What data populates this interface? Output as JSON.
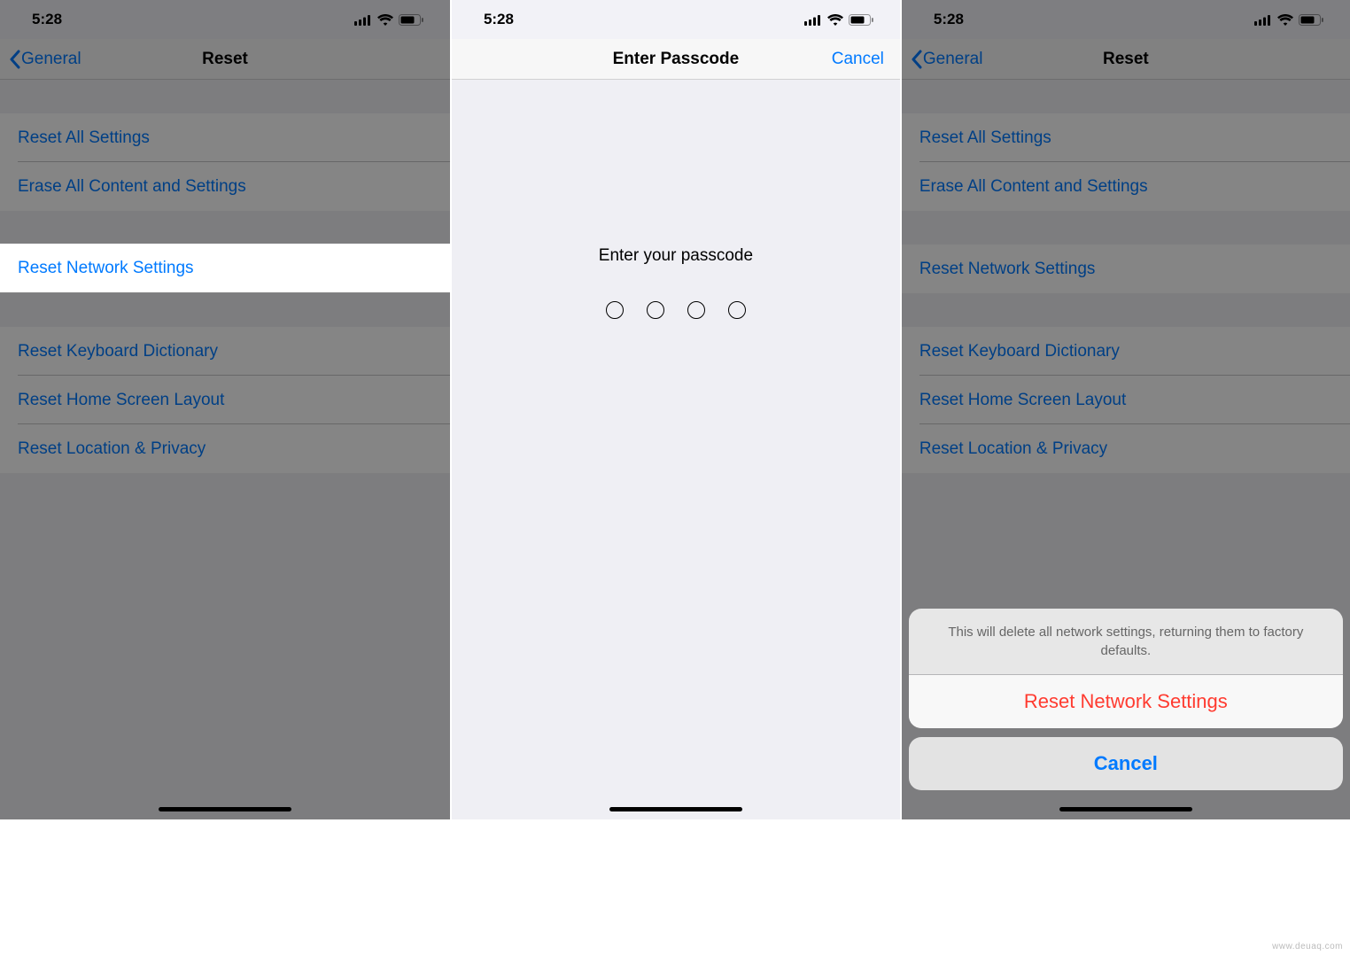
{
  "status": {
    "time": "5:28"
  },
  "nav": {
    "back_label": "General",
    "reset_title": "Reset",
    "passcode_title": "Enter Passcode",
    "cancel": "Cancel"
  },
  "cells": {
    "reset_all": "Reset All Settings",
    "erase_all": "Erase All Content and Settings",
    "reset_network": "Reset Network Settings",
    "reset_keyboard": "Reset Keyboard Dictionary",
    "reset_home": "Reset Home Screen Layout",
    "reset_location": "Reset Location & Privacy"
  },
  "passcode": {
    "prompt": "Enter your passcode"
  },
  "sheet": {
    "message": "This will delete all network settings, returning them to factory defaults.",
    "confirm": "Reset Network Settings",
    "cancel": "Cancel"
  },
  "watermark": "www.deuaq.com"
}
